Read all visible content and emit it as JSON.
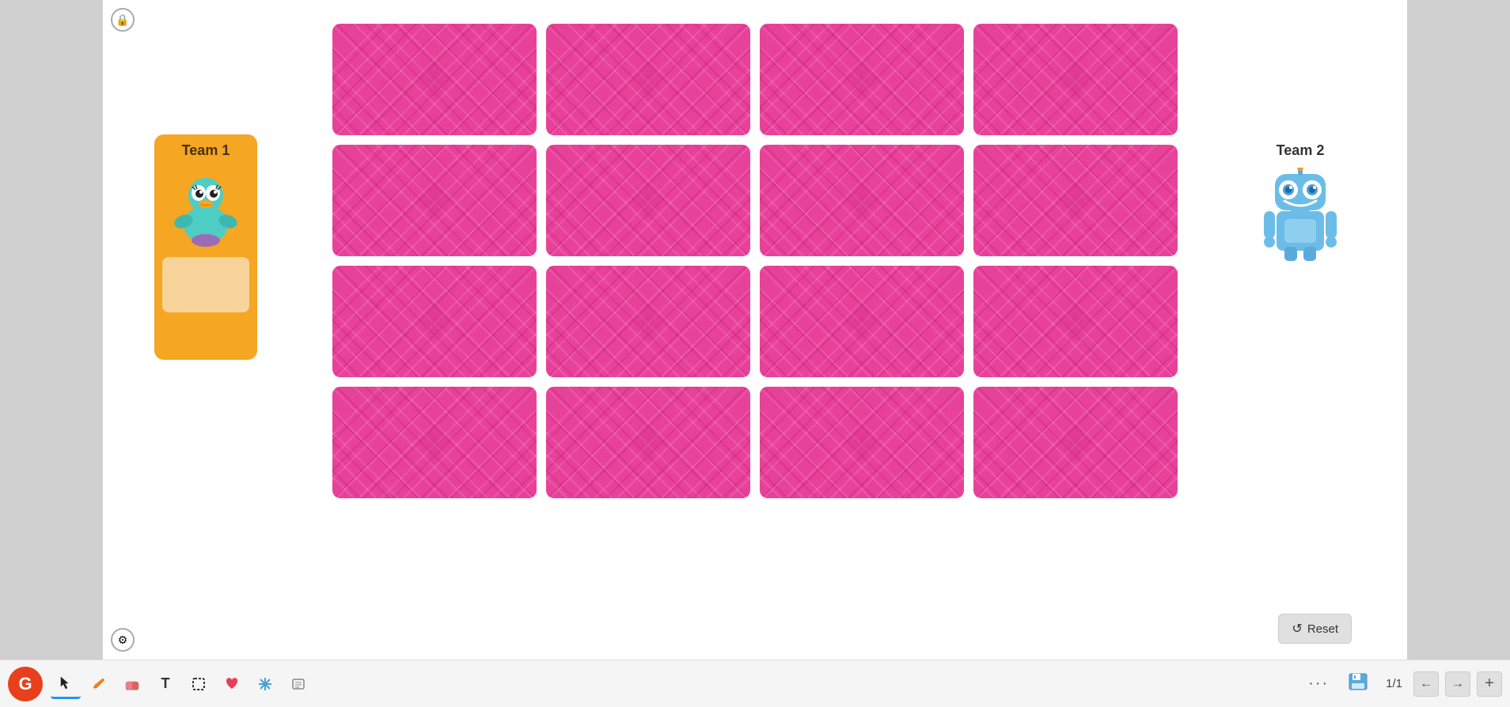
{
  "team1": {
    "label": "Team 1",
    "avatar": "duck",
    "score": ""
  },
  "team2": {
    "label": "Team 2",
    "avatar": "robot"
  },
  "cards": {
    "rows": 4,
    "cols": 4,
    "total": 16
  },
  "reset_button": {
    "label": "Reset"
  },
  "toolbar": {
    "g_logo": "G",
    "cursor_tool": "cursor",
    "pencil_tool": "pencil",
    "eraser_tool": "eraser",
    "text_tool": "T",
    "select_tool": "select",
    "heart_tool": "heart",
    "snowflake_tool": "snowflake",
    "list_tool": "list",
    "dots_label": "···",
    "save_label": "💾",
    "page_counter": "1/1",
    "prev_label": "←",
    "next_label": "→",
    "add_label": "+"
  },
  "icons": {
    "lock": "🔒",
    "settings": "⚙"
  }
}
